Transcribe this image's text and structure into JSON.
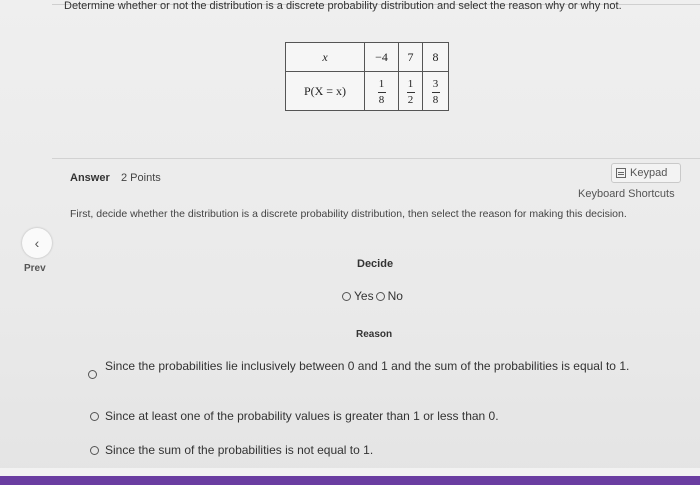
{
  "question": "Determine whether or not the distribution is a discrete probability distribution and select the reason why or why not.",
  "table": {
    "x_label": "x",
    "p_label": "P(X = x)",
    "x_values": [
      "−4",
      "7",
      "8"
    ],
    "p_values": [
      {
        "num": "1",
        "den": "8"
      },
      {
        "num": "1",
        "den": "2"
      },
      {
        "num": "3",
        "den": "8"
      }
    ]
  },
  "answer": {
    "title": "Answer",
    "points": "2 Points",
    "keypad_label": "Keypad",
    "keypad_icon": "keypad-icon",
    "shortcuts_label": "Keyboard Shortcuts",
    "instructions": "First, decide whether the distribution is a discrete probability distribution, then select the reason for making this decision."
  },
  "nav": {
    "prev_icon": "chevron-left-icon",
    "prev_label": "Prev"
  },
  "decide": {
    "title": "Decide",
    "yes_label": "Yes",
    "no_label": "No"
  },
  "reason": {
    "title": "Reason",
    "options": [
      "Since the probabilities lie inclusively between 0 and 1 and the sum of the probabilities is equal to 1.",
      "Since at least one of the probability values is greater than 1 or less than 0.",
      "Since the sum of the probabilities is not equal to 1."
    ]
  },
  "colors": {
    "accent_bar": "#6a3da1"
  }
}
